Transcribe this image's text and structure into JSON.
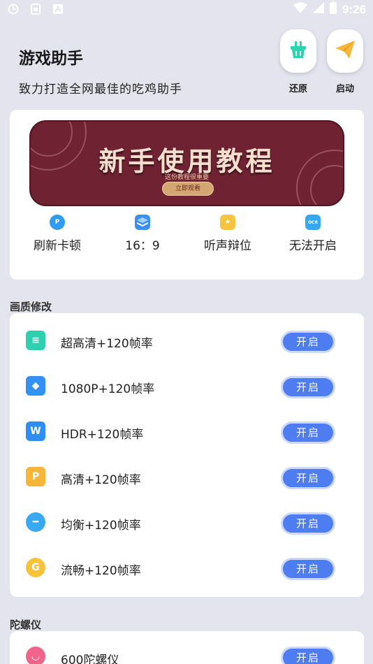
{
  "status_bar": {
    "time": "9:26",
    "left_icons": [
      "sync-icon",
      "sim-icon",
      "a-icon"
    ],
    "right_icons": [
      "wifi-icon",
      "signal-icon",
      "battery-icon"
    ]
  },
  "header": {
    "title": "游戏助手",
    "subtitle": "致力打造全网最佳的吃鸡助手",
    "actions": [
      {
        "label": "还原",
        "icon": "basket-icon",
        "color": "#2fd3b0"
      },
      {
        "label": "启动",
        "icon": "paper-plane-icon",
        "color": "#f6b93b"
      }
    ]
  },
  "banner": {
    "title": "新手使用教程",
    "subtitle": "这份教程很重要",
    "button_label": "立即观看"
  },
  "quick_actions": [
    {
      "label": "刷新卡顿",
      "icon": "p-circle-icon",
      "icon_text": "P",
      "color": "#2f9cf2"
    },
    {
      "label": "16：9",
      "icon": "layers-icon",
      "icon_text": "",
      "color": "#3a8ff0"
    },
    {
      "label": "听声辩位",
      "icon": "star-badge-icon",
      "icon_text": "★",
      "color": "#f5c542"
    },
    {
      "label": "无法开启",
      "icon": "ocr-icon",
      "icon_text": "OCR",
      "color": "#36a8f2"
    }
  ],
  "sections": {
    "quality": {
      "title": "画质修改",
      "items": [
        {
          "label": "超高清+120帧率",
          "icon": "inbox-icon",
          "icon_text": "≡",
          "color": "#2fd0b0",
          "button": "开启"
        },
        {
          "label": "1080P+120帧率",
          "icon": "document-stack-icon",
          "icon_text": "◆",
          "color": "#3391f3",
          "button": "开启"
        },
        {
          "label": "HDR+120帧率",
          "icon": "word-doc-icon",
          "icon_text": "W",
          "color": "#2f8ef3",
          "button": "开启"
        },
        {
          "label": "高清+120帧率",
          "icon": "ppt-doc-icon",
          "icon_text": "P",
          "color": "#f7b53a",
          "button": "开启"
        },
        {
          "label": "均衡+120帧率",
          "icon": "cloud-icon",
          "icon_text": "━",
          "color": "#37a9f0",
          "button": "开启"
        },
        {
          "label": "流畅+120帧率",
          "icon": "coin-icon",
          "icon_text": "G",
          "color": "#f6c33c",
          "button": "开启"
        }
      ]
    },
    "gyro": {
      "title": "陀螺仪",
      "items": [
        {
          "label": "600陀螺仪",
          "icon": "gyro-icon",
          "icon_text": "◡",
          "color": "#f0648a",
          "button": "开启"
        }
      ]
    }
  }
}
